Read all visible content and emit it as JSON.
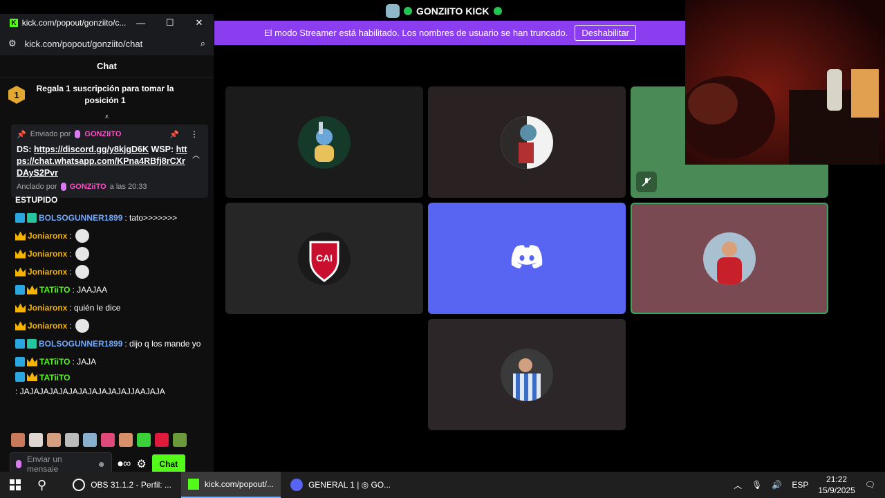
{
  "call": {
    "server_name": "GONZIITO KICK",
    "streamer_banner": "El modo Streamer está habilitado. Los nombres de usuario se han truncado.",
    "disable_button": "Deshabilitar"
  },
  "browser": {
    "title": "kick.com/popout/gonziito/c...",
    "url": "kick.com/popout/gonziito/chat"
  },
  "chat": {
    "header": "Chat",
    "gift_rank": "1",
    "gift_text": "Regala 1 suscripción para tomar la posición 1",
    "pinned": {
      "sent_by_label": "Enviado por",
      "author": "GONZIiTO",
      "text_prefix_ds": "DS:",
      "discord_link": "https://discord.gg/y8kjgD6K",
      "text_prefix_wsp": "WSP:",
      "whatsapp_link": "https://chat.whatsapp.com/KPna4RBfj8rCXrDAyS2Pvr",
      "pinned_by_label": "Anclado por",
      "pinned_by": "GONZiiTO",
      "pinned_time": "a las 20:33"
    },
    "messages": [
      {
        "user": "ESTUPIDO",
        "text": "",
        "badges": [],
        "color": "#ffffff"
      },
      {
        "user": "BOLSOGUNNER1899",
        "text": ": tato>>>>>>>",
        "badges": [
          "blue",
          "green"
        ],
        "color": "#6fa8ff"
      },
      {
        "user": "Joniaronx",
        "text": ":",
        "badges": [
          "crown"
        ],
        "color": "#f5b400",
        "emote": true
      },
      {
        "user": "Joniaronx",
        "text": ":",
        "badges": [
          "crown"
        ],
        "color": "#f5b400",
        "emote": true
      },
      {
        "user": "Joniaronx",
        "text": ":",
        "badges": [
          "crown"
        ],
        "color": "#f5b400",
        "emote": true
      },
      {
        "user": "TATiiTO",
        "text": ": JAAJAA",
        "badges": [
          "blue",
          "crown"
        ],
        "color": "#53fc18"
      },
      {
        "user": "Joniaronx",
        "text": ": quién le dice",
        "badges": [
          "crown"
        ],
        "color": "#f5b400"
      },
      {
        "user": "Joniaronx",
        "text": ":",
        "badges": [
          "crown"
        ],
        "color": "#f5b400",
        "emote": true
      },
      {
        "user": "BOLSOGUNNER1899",
        "text": ": dijo q los mande yo",
        "badges": [
          "blue",
          "green"
        ],
        "color": "#6fa8ff"
      },
      {
        "user": "TATiiTO",
        "text": ": JAJA",
        "badges": [
          "blue",
          "crown"
        ],
        "color": "#53fc18"
      },
      {
        "user": "TATiiTO",
        "text": ": JAJAJAJAJAJAJAJAJAJAJAJJAAJAJA",
        "badges": [
          "blue",
          "crown"
        ],
        "color": "#53fc18"
      }
    ],
    "input_placeholder": "Enviar un mensaje",
    "send_button": "Chat"
  },
  "taskbar": {
    "items": [
      {
        "label": "OBS 31.1.2 - Perfil: ..."
      },
      {
        "label": "kick.com/popout/..."
      },
      {
        "label": "GENERAL 1 | ◎ GO..."
      }
    ],
    "language": "ESP",
    "time": "21:22",
    "date": "15/9/2025"
  },
  "colors": {
    "kick_green": "#53fc18",
    "streamer_purple": "#8a3ef0",
    "discord_blurple": "#5865f2"
  }
}
